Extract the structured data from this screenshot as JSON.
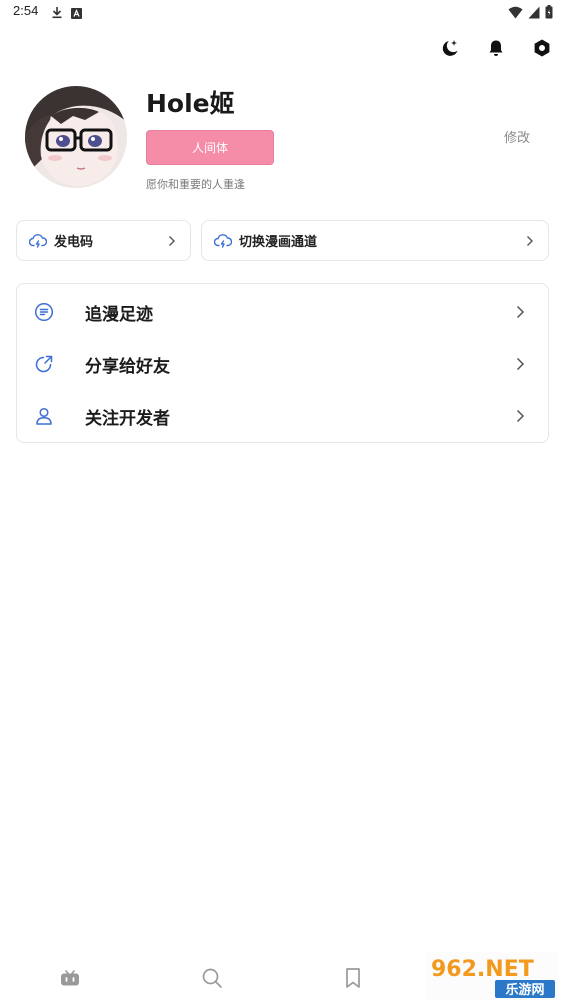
{
  "status_bar": {
    "time": "2:54",
    "left_icons": [
      "download-icon",
      "font-a-icon"
    ],
    "right_icons": [
      "wifi-icon",
      "signal-icon",
      "battery-icon"
    ]
  },
  "header": {
    "icons": [
      "night-mode-icon",
      "bell-icon",
      "settings-icon"
    ]
  },
  "profile": {
    "username": "Hole姬",
    "tag_label": "人间体",
    "bio": "愿你和重要的人重逢",
    "edit_label": "修改",
    "tag_color": "#f58ca8"
  },
  "quick_actions": [
    {
      "label": "发电码",
      "icon": "cloud-lightning-icon"
    },
    {
      "label": "切换漫画通道",
      "icon": "cloud-lightning-icon"
    }
  ],
  "menu": [
    {
      "label": "追漫足迹",
      "icon": "list-icon"
    },
    {
      "label": "分享给好友",
      "icon": "share-icon"
    },
    {
      "label": "关注开发者",
      "icon": "user-icon"
    }
  ],
  "bottom_nav": {
    "items": [
      "home-icon",
      "search-icon",
      "bookmark-icon"
    ]
  },
  "watermark": {
    "brand": "962.NET",
    "subtitle": "乐游网"
  },
  "colors": {
    "accent": "#3d6fd6",
    "pink": "#f58ca8",
    "border": "#e4e6eb"
  }
}
